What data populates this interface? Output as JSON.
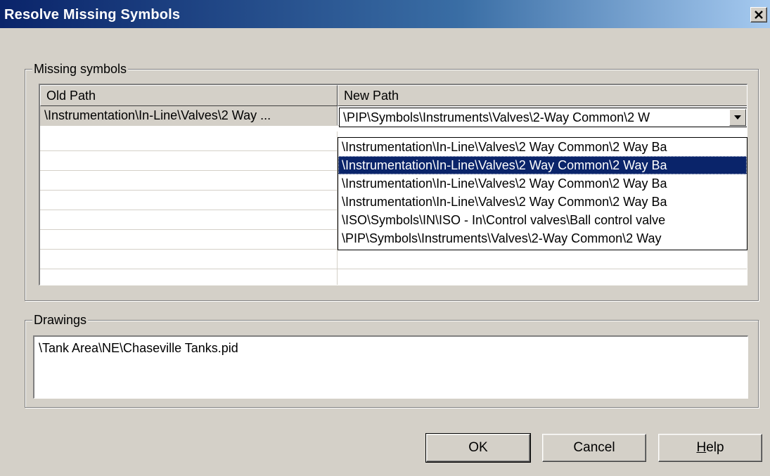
{
  "window": {
    "title": "Resolve Missing Symbols"
  },
  "missing_symbols": {
    "group_label": "Missing symbols",
    "columns": {
      "old_path": "Old Path",
      "new_path": "New Path"
    },
    "rows": [
      {
        "old_path": "\\Instrumentation\\In-Line\\Valves\\2 Way ...",
        "new_path": "\\PIP\\Symbols\\Instruments\\Valves\\2-Way Common\\2 W"
      }
    ],
    "dropdown": {
      "options": [
        "\\Instrumentation\\In-Line\\Valves\\2 Way Common\\2 Way Ba",
        "\\Instrumentation\\In-Line\\Valves\\2 Way Common\\2 Way Ba",
        "\\Instrumentation\\In-Line\\Valves\\2 Way Common\\2 Way Ba",
        "\\Instrumentation\\In-Line\\Valves\\2 Way Common\\2 Way Ba",
        "\\ISO\\Symbols\\IN\\ISO - In\\Control valves\\Ball control valve",
        "\\PIP\\Symbols\\Instruments\\Valves\\2-Way Common\\2 Way"
      ],
      "highlighted_index": 1
    }
  },
  "drawings": {
    "group_label": "Drawings",
    "items": [
      "\\Tank Area\\NE\\Chaseville Tanks.pid"
    ]
  },
  "buttons": {
    "ok": "OK",
    "cancel": "Cancel",
    "help_accel": "H",
    "help_rest": "elp"
  },
  "icons": {
    "close": "close-icon",
    "dropdown_arrow": "chevron-down-icon"
  },
  "colors": {
    "title_bar": "#0a246a",
    "selection": "#0a246a",
    "dialog_face": "#d4d0c8"
  }
}
